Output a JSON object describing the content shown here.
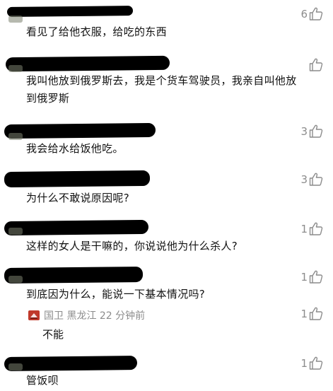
{
  "comments": [
    {
      "text": "看见了给他衣服，给吃的东西",
      "likes": "6"
    },
    {
      "text_line1": "我叫他放到俄罗斯去，我是个货车驾驶员，我亲自叫他放",
      "text_line2": "到俄罗斯",
      "likes": ""
    },
    {
      "text": "我会给水给饭他吃。",
      "likes": "3"
    },
    {
      "text": "为什么不敢说原因呢?",
      "likes": "3"
    },
    {
      "text": "这样的女人是干嘛的，你说说他为什么杀人?",
      "likes": "1"
    },
    {
      "text": "到底因为什么，能说一下基本情况吗?",
      "likes": "1",
      "reply": {
        "location": "国卫  黑龙江 22 分钟前",
        "text": "不能",
        "likes": "1"
      }
    },
    {
      "text": "管饭呗",
      "likes": "1"
    }
  ],
  "icons": {
    "like": "thumbs-up-icon",
    "reply_avatar": "flag-avatar-icon"
  },
  "colors": {
    "meta": "#8c8c8c",
    "text": "#111111",
    "redaction": "#000000"
  }
}
